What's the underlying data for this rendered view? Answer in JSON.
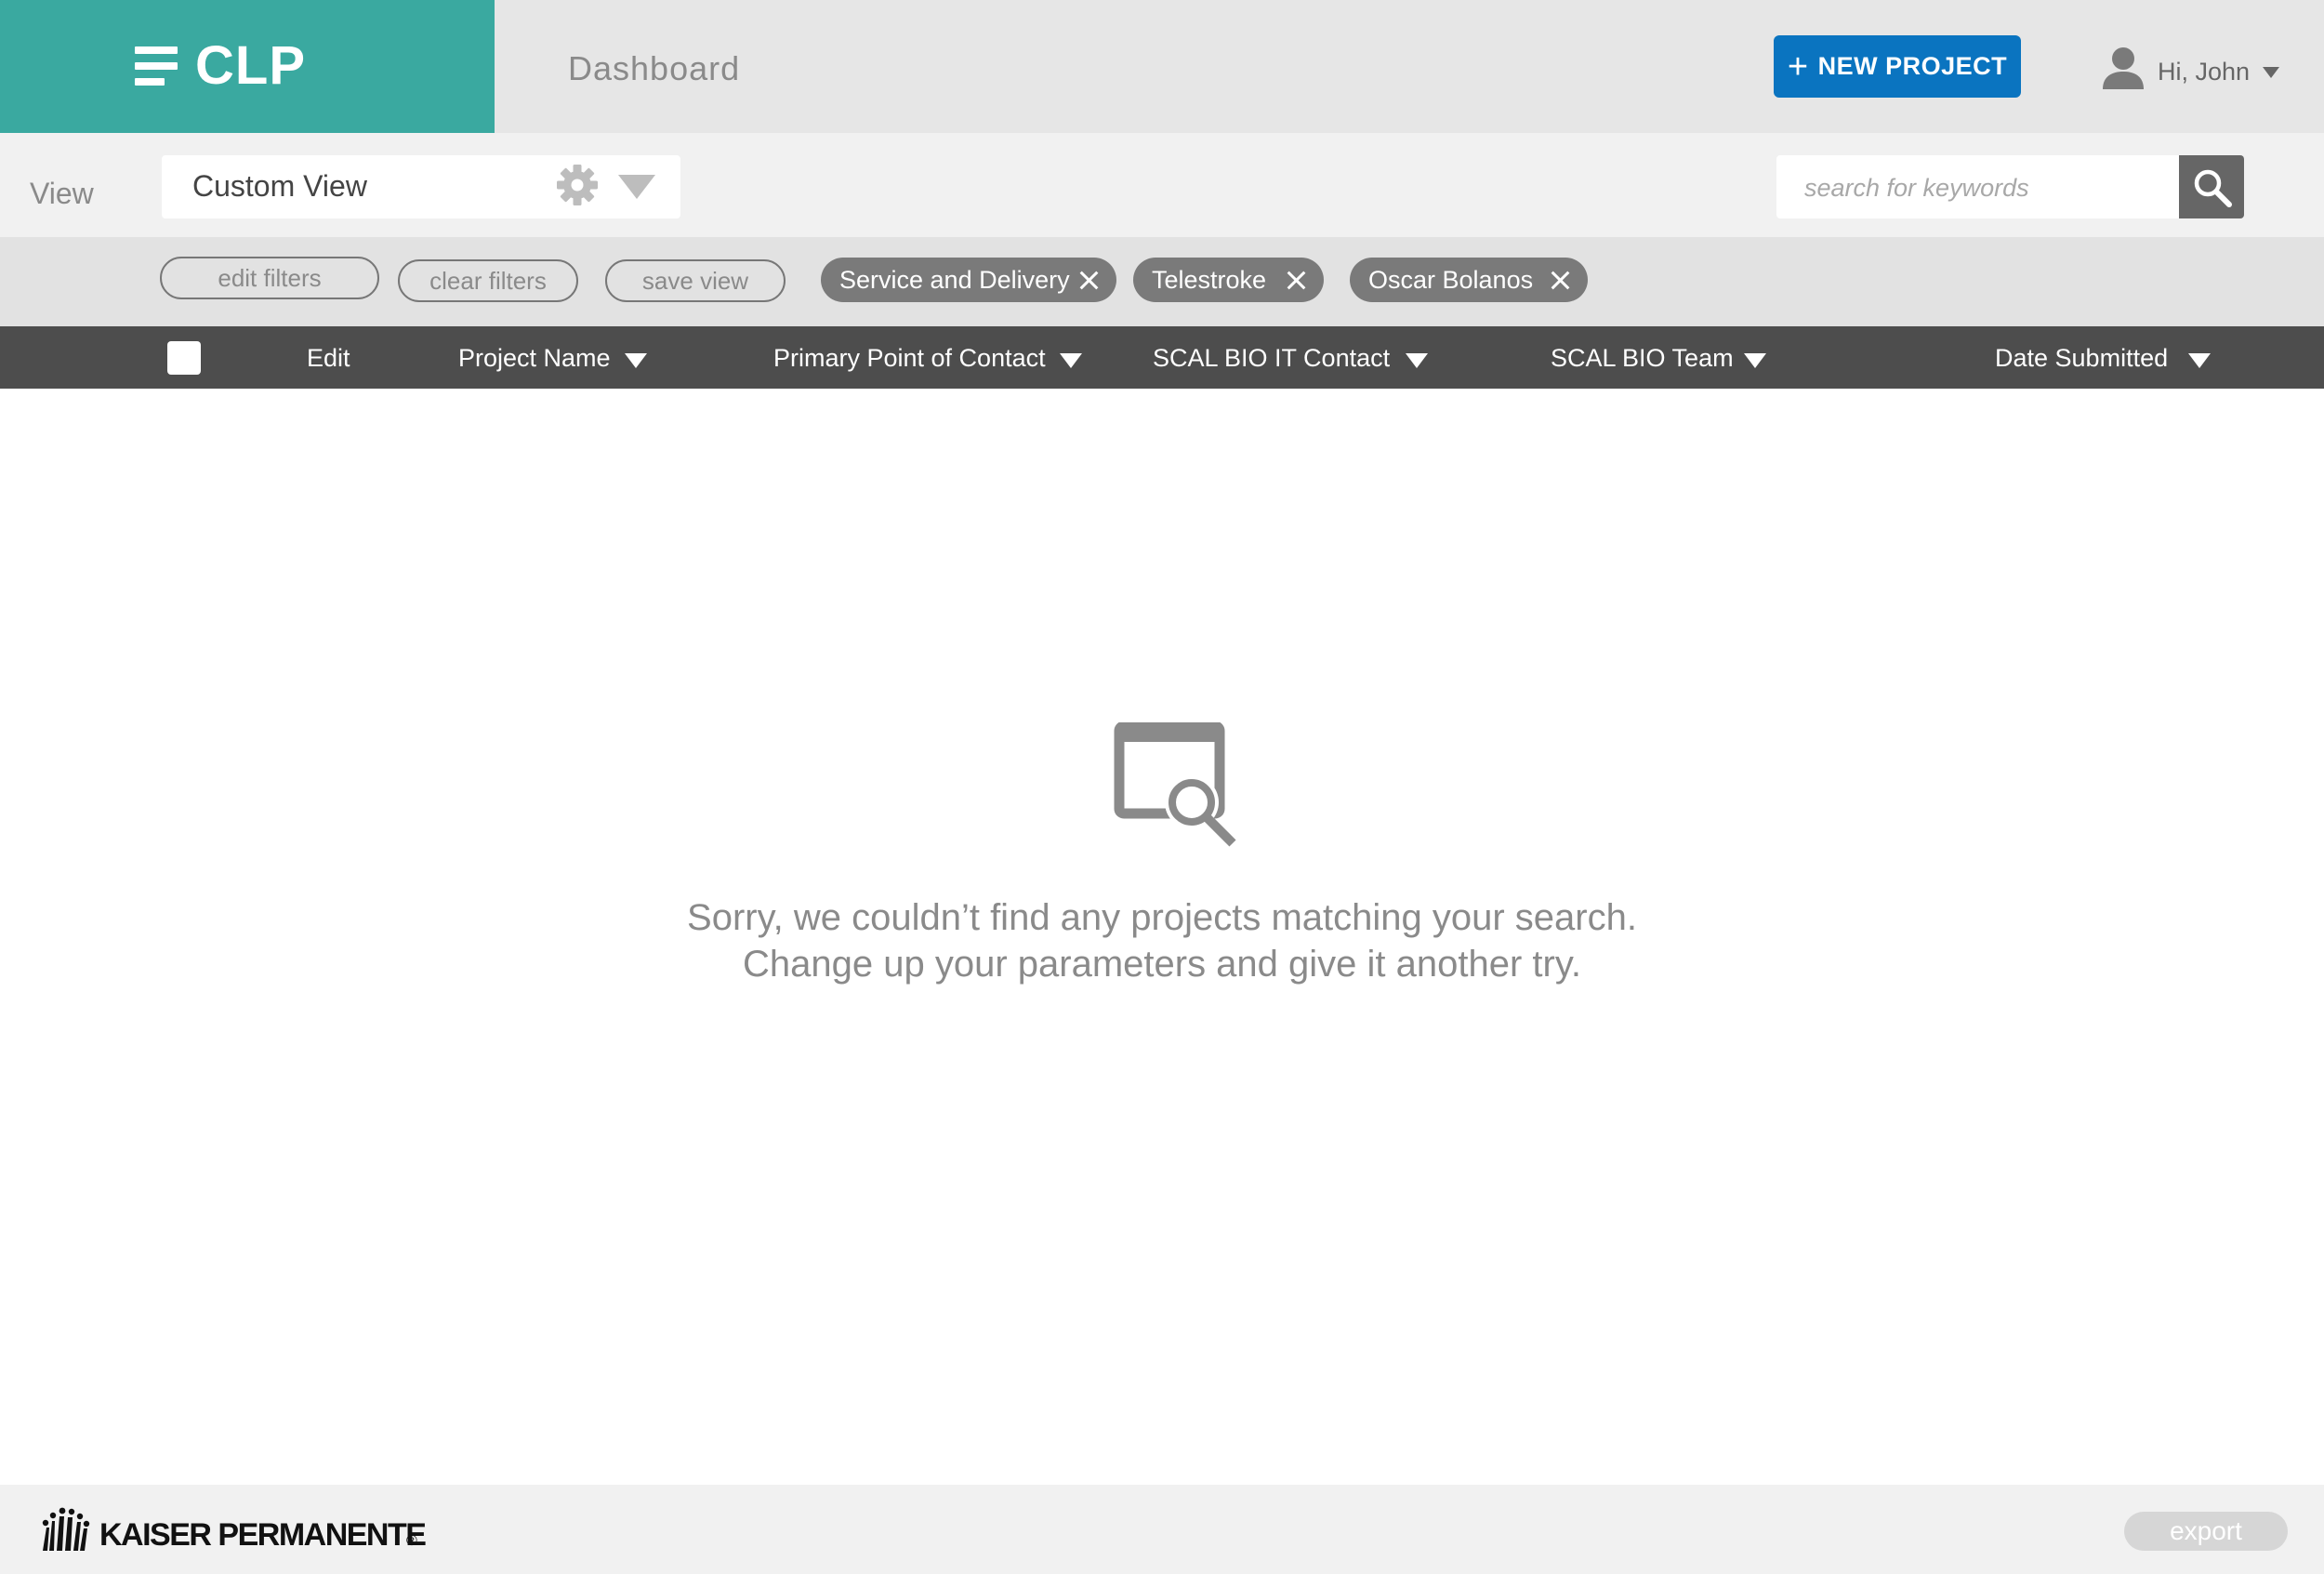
{
  "header": {
    "logo_text": "CLP",
    "page_title": "Dashboard",
    "new_project_label": "NEW PROJECT",
    "new_project_icon": "plus-icon",
    "user_greeting": "Hi, John",
    "brand_color": "#3aa9a0",
    "accent_color": "#0a74c0"
  },
  "view_bar": {
    "view_label": "View",
    "selected_view": "Custom View",
    "search_placeholder": "search for keywords"
  },
  "filter_bar": {
    "edit_filters_label": "edit filters",
    "clear_filters_label": "clear filters",
    "save_view_label": "save view",
    "active_filters": [
      "Service and Delivery",
      "Telestroke",
      "Oscar Bolanos"
    ]
  },
  "table": {
    "columns": [
      "Edit",
      "Project Name",
      "Primary Point of Contact",
      "SCAL BIO IT Contact",
      "SCAL BIO Team",
      "Date Submitted"
    ]
  },
  "empty_state": {
    "icon": "search-results-icon",
    "line1": "Sorry, we couldn’t find any projects matching your search.",
    "line2": "Change up your parameters and give it another try."
  },
  "footer": {
    "brand_text": "KAISER PERMANENTE",
    "registered_mark": "®",
    "export_label": "export"
  }
}
